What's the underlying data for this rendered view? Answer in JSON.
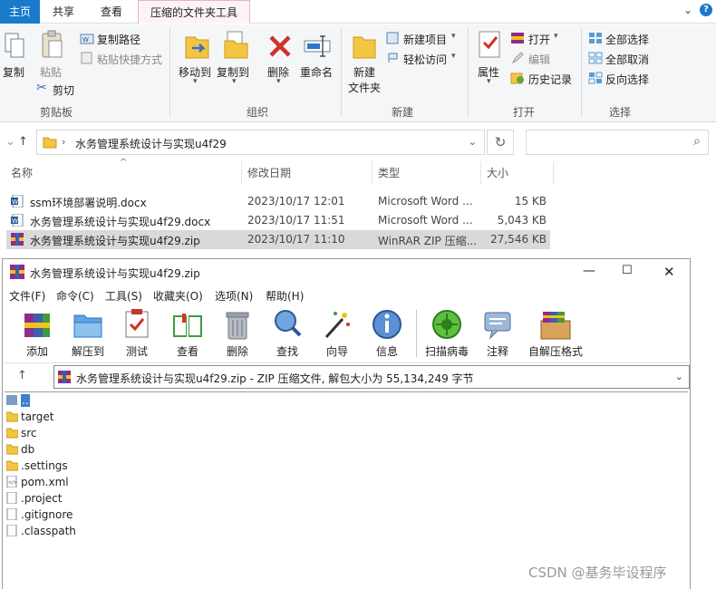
{
  "tabs": {
    "home": "主页",
    "share": "共享",
    "view": "查看",
    "tools": "压缩的文件夹工具"
  },
  "ribbon": {
    "clipboard": {
      "copy": "复制",
      "paste": "粘贴",
      "copy_path": "复制路径",
      "paste_shortcut": "粘贴快捷方式",
      "cut": "剪切",
      "label": "剪贴板"
    },
    "organize": {
      "move_to": "移动到",
      "copy_to": "复制到",
      "delete": "删除",
      "rename": "重命名",
      "label": "组织"
    },
    "new": {
      "new_folder_line1": "新建",
      "new_folder_line2": "文件夹",
      "new_item": "新建项目",
      "easy_access": "轻松访问",
      "label": "新建"
    },
    "open": {
      "properties": "属性",
      "open": "打开",
      "edit": "编辑",
      "history": "历史记录",
      "label": "打开"
    },
    "select": {
      "select_all": "全部选择",
      "select_none": "全部取消",
      "invert": "反向选择",
      "label": "选择"
    }
  },
  "address": {
    "path": "水务管理系统设计与实现u4f29"
  },
  "file_list": {
    "headers": {
      "name": "名称",
      "date": "修改日期",
      "type": "类型",
      "size": "大小"
    },
    "rows": [
      {
        "icon": "word-doc-icon",
        "name": "ssm环境部署说明.docx",
        "date": "2023/10/17 12:01",
        "type": "Microsoft Word ...",
        "size": "15 KB"
      },
      {
        "icon": "word-doc-icon",
        "name": "水务管理系统设计与实现u4f29.docx",
        "date": "2023/10/17 11:51",
        "type": "Microsoft Word ...",
        "size": "5,043 KB"
      },
      {
        "icon": "winrar-archive-icon",
        "name": "水务管理系统设计与实现u4f29.zip",
        "date": "2023/10/17 11:10",
        "type": "WinRAR ZIP 压缩...",
        "size": "27,546 KB"
      }
    ]
  },
  "winrar": {
    "title": "水务管理系统设计与实现u4f29.zip",
    "menu": [
      "文件(F)",
      "命令(C)",
      "工具(S)",
      "收藏夹(O)",
      "选项(N)",
      "帮助(H)"
    ],
    "toolbar": [
      "添加",
      "解压到",
      "测试",
      "查看",
      "删除",
      "查找",
      "向导",
      "信息",
      "扫描病毒",
      "注释",
      "自解压格式"
    ],
    "path_text": "水务管理系统设计与实现u4f29.zip - ZIP 压缩文件, 解包大小为 55,134,249 字节",
    "entries": [
      {
        "name": "..",
        "kind": "up"
      },
      {
        "name": "target",
        "kind": "folder"
      },
      {
        "name": "src",
        "kind": "folder"
      },
      {
        "name": "db",
        "kind": "folder"
      },
      {
        "name": ".settings",
        "kind": "folder"
      },
      {
        "name": "pom.xml",
        "kind": "xml"
      },
      {
        "name": ".project",
        "kind": "file"
      },
      {
        "name": ".gitignore",
        "kind": "file"
      },
      {
        "name": ".classpath",
        "kind": "file"
      }
    ]
  },
  "watermark": "CSDN @基务毕设程序",
  "colors": {
    "accent_blue": "#1979ca",
    "selection_gray": "#d9d9d9",
    "folder_yellow": "#f4c542",
    "rar_selection": "#3d7fcf"
  }
}
